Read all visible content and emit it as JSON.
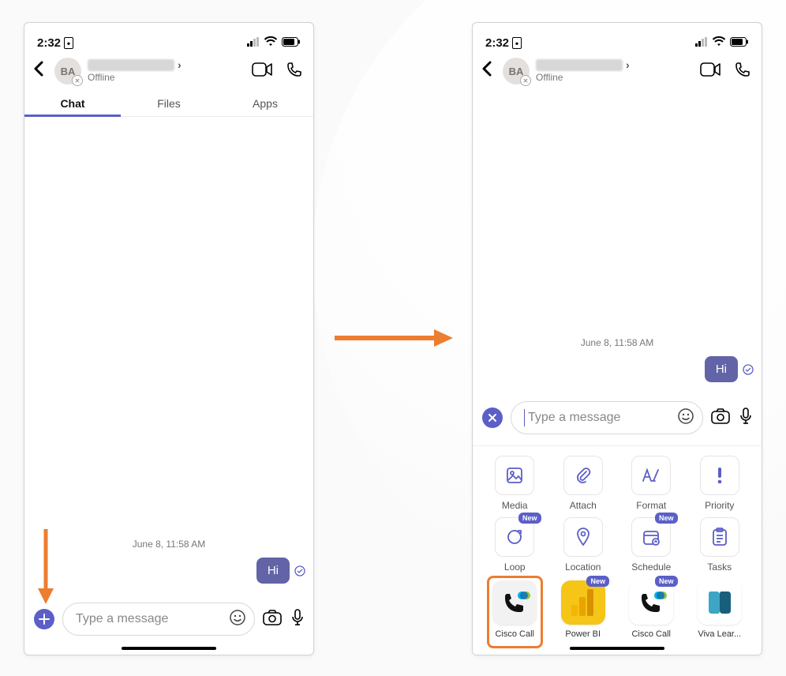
{
  "status_bar": {
    "time": "2:32",
    "card_icon": "sim-card-icon"
  },
  "header": {
    "avatar_initials": "BA",
    "presence": "Offline"
  },
  "tabs": [
    {
      "label": "Chat",
      "active": true
    },
    {
      "label": "Files",
      "active": false
    },
    {
      "label": "Apps",
      "active": false
    }
  ],
  "chat": {
    "timestamp": "June 8, 11:58 AM",
    "message_text": "Hi"
  },
  "compose": {
    "placeholder": "Type a message"
  },
  "drawer": {
    "options": [
      {
        "label": "Media",
        "icon": "image-icon"
      },
      {
        "label": "Attach",
        "icon": "paperclip-icon"
      },
      {
        "label": "Format",
        "icon": "format-icon"
      },
      {
        "label": "Priority",
        "icon": "exclaim-icon"
      },
      {
        "label": "Loop",
        "icon": "loop-icon",
        "new": true
      },
      {
        "label": "Location",
        "icon": "pin-icon"
      },
      {
        "label": "Schedule",
        "icon": "calendar-icon",
        "new": true
      },
      {
        "label": "Tasks",
        "icon": "tasks-icon"
      }
    ],
    "apps": [
      {
        "label": "Cisco Call",
        "icon": "cisco-call-icon",
        "bg": "#f2f2f2",
        "highlighted": true
      },
      {
        "label": "Power BI",
        "icon": "powerbi-icon",
        "bg": "#f5c518",
        "new": true
      },
      {
        "label": "Cisco Call",
        "icon": "cisco-call-icon",
        "bg": "#ffffff",
        "new": true
      },
      {
        "label": "Viva Lear...",
        "icon": "viva-icon",
        "bg": "#ffffff"
      }
    ],
    "new_badge_text": "New"
  }
}
